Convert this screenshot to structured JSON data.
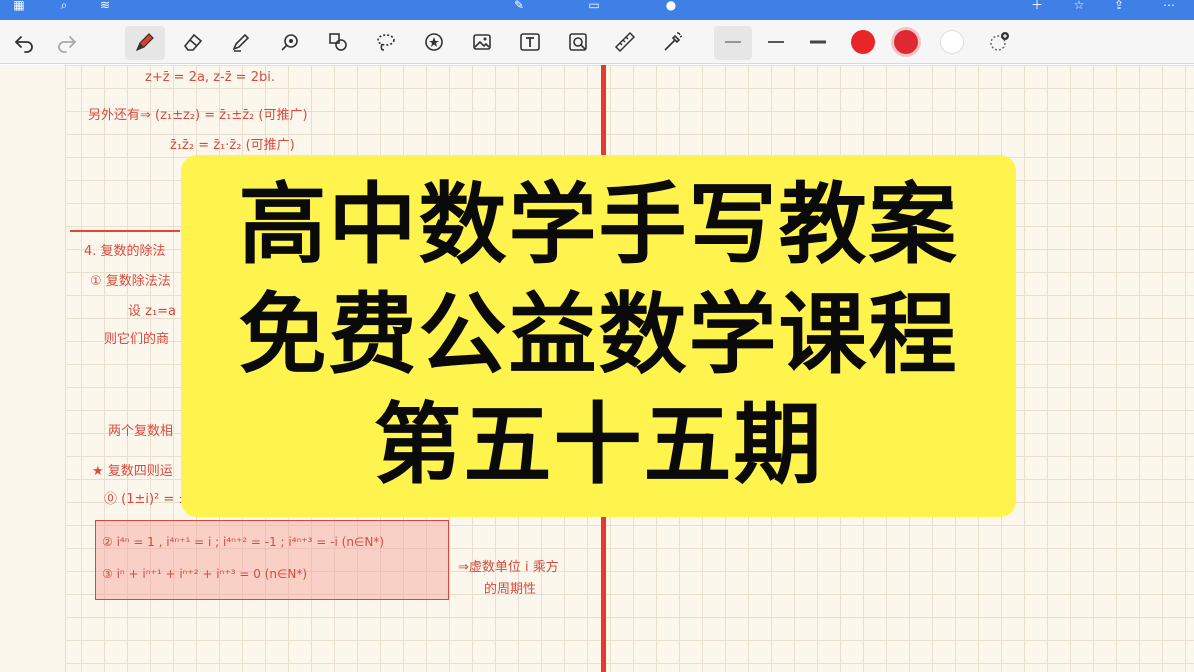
{
  "toolbar": {
    "tools": [
      "undo-icon",
      "redo-icon",
      "pen-icon",
      "eraser-icon",
      "highlighter-icon",
      "lasso-shape-icon",
      "shapes-icon",
      "lasso-icon",
      "sticker-icon",
      "image-icon",
      "text-icon",
      "camera-image-icon",
      "ruler-icon",
      "laser-icon"
    ],
    "stroke_widths": [
      "thin",
      "medium",
      "thick"
    ],
    "colors": [
      "#e8262a",
      "#e02a33",
      "#ffffff"
    ]
  },
  "notes": {
    "line1": "z+z̄ = 2a, z-z̄ = 2bi.",
    "line2": "另外还有⇒ (z₁±z₂) = z̄₁±z̄₂ (可推广)",
    "line3": "z̄₁z̄₂ = z̄₁·z̄₂ (可推广)",
    "heading4": "4. 复数的除法",
    "sub1": "① 复数除法法",
    "set": "设 z₁=a",
    "then": "则它们的商",
    "two": "两个复数相",
    "star": "★ 复数四则运",
    "item0": "⓪ (1±i)² = ±",
    "box1": "② i⁴ⁿ = 1 , i⁴ⁿ⁺¹ = i ; i⁴ⁿ⁺² = -1 ; i⁴ⁿ⁺³ = -i (n∈N*)",
    "box2": "③ iⁿ + iⁿ⁺¹ + iⁿ⁺² + iⁿ⁺³ = 0 (n∈N*)",
    "side1": "⇒虚数单位 i 乘方",
    "side2": "的周期性"
  },
  "banner": {
    "line1": "高中数学手写教案",
    "line2": "免费公益数学课程",
    "line3": "第五十五期"
  }
}
